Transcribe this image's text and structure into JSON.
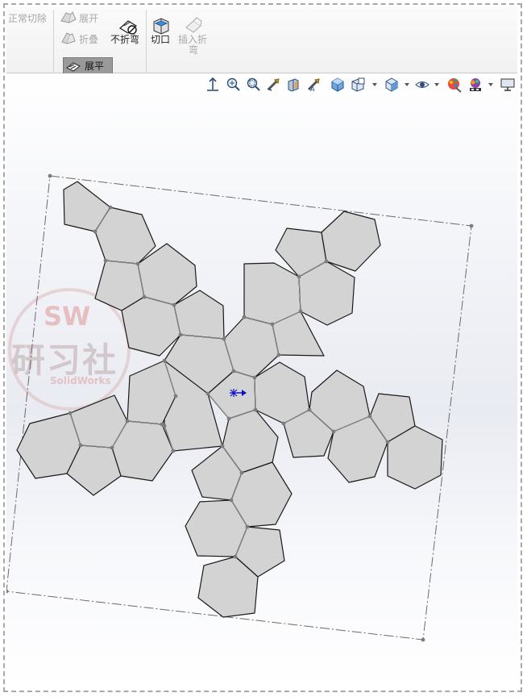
{
  "ribbon": {
    "normal_cut_label": "正常切除",
    "unfold_label": "展开",
    "fold_label": "折叠",
    "no_bends_label": "不折弯",
    "rip_label": "切口",
    "insert_bends_line1": "插入折",
    "insert_bends_line2": "弯",
    "flatten_label": "展平"
  },
  "toolbar": {
    "items": [
      "view-orientation-icon",
      "zoom-to-fit-icon",
      "zoom-to-area-icon",
      "previous-view-icon",
      "section-view-icon",
      "dynamic-annotation-icon",
      "view-orientation-cube-icon",
      "display-style-icon",
      "hide-show-items-icon",
      "edit-appearance-icon",
      "apply-scene-icon",
      "view-settings-icon"
    ]
  },
  "watermark": {
    "brand": "SW",
    "title": "研习社",
    "sub": "SolidWorks"
  },
  "colors": {
    "face_fill": "#d3d3d3",
    "face_stroke": "#1a1a1a",
    "bend_line": "#8c8c8c",
    "bounding_box": "#6a6a6a",
    "origin_arrow": "#1010cc"
  }
}
